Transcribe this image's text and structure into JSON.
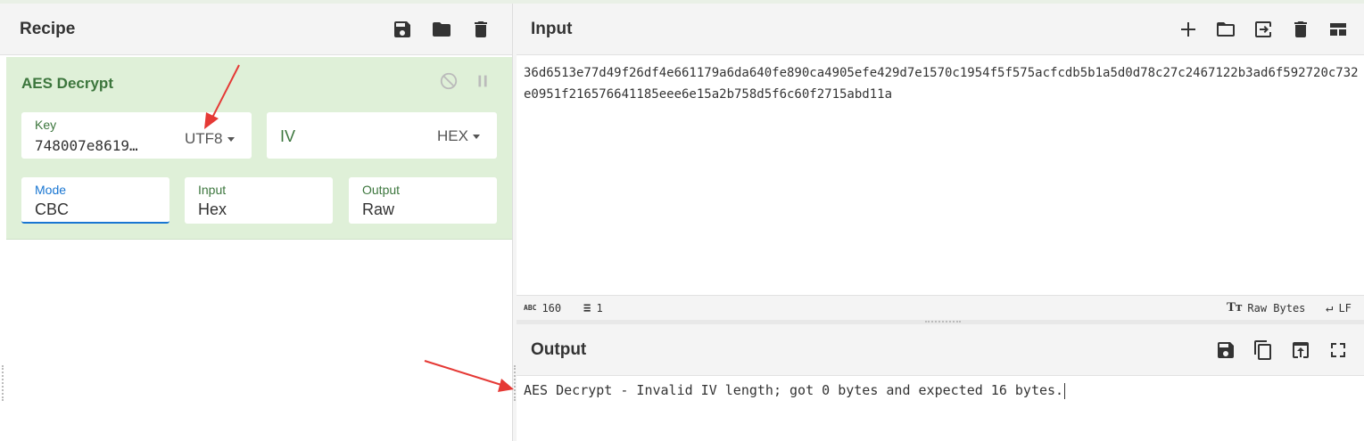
{
  "recipe": {
    "title": "Recipe",
    "icons": [
      "save-icon",
      "folder-icon",
      "trash-icon"
    ],
    "operation": {
      "name": "AES Decrypt",
      "key": {
        "label": "Key",
        "value": "748007e8619…",
        "encoding": "UTF8"
      },
      "iv": {
        "label": "IV",
        "encoding": "HEX"
      },
      "mode": {
        "label": "Mode",
        "value": "CBC"
      },
      "input": {
        "label": "Input",
        "value": "Hex"
      },
      "output": {
        "label": "Output",
        "value": "Raw"
      }
    }
  },
  "input": {
    "title": "Input",
    "text": "36d6513e77d49f26df4e661179a6da640fe890ca4905efe429d7e1570c1954f5f575acfcdb5b1a5d0d78c27c2467122b3ad6f592720c732e0951f216576641185eee6e15a2b758d5f6c60f2715abd11a",
    "status": {
      "chars": "160",
      "lines": "1",
      "format": "Raw Bytes",
      "eol": "LF"
    }
  },
  "output": {
    "title": "Output",
    "text": "AES Decrypt - Invalid IV length; got 0 bytes and expected 16 bytes."
  },
  "colors": {
    "operation_bg": "#dff0d8",
    "operation_title": "#3c763d",
    "focus_underline": "#1976d2",
    "annotation_arrow": "#e53935"
  }
}
